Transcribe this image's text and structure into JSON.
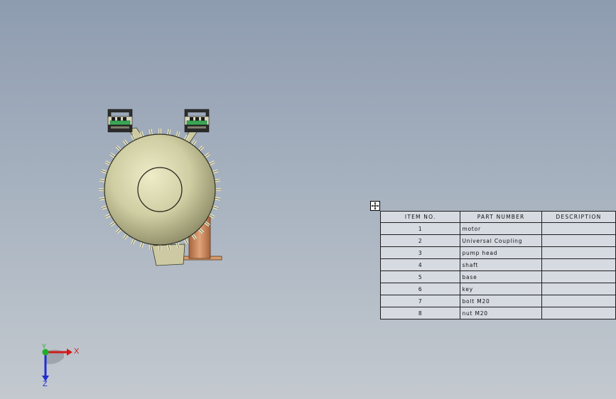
{
  "bom": {
    "headers": [
      "ITEM NO.",
      "PART NUMBER",
      "DESCRIPTION"
    ],
    "rows": [
      {
        "item": "1",
        "part": "motor",
        "description": ""
      },
      {
        "item": "2",
        "part": "Universal Coupling",
        "description": ""
      },
      {
        "item": "3",
        "part": "pump head",
        "description": ""
      },
      {
        "item": "4",
        "part": "shaft",
        "description": ""
      },
      {
        "item": "5",
        "part": "base",
        "description": ""
      },
      {
        "item": "6",
        "part": "key",
        "description": ""
      },
      {
        "item": "7",
        "part": "bolt M20",
        "description": ""
      },
      {
        "item": "8",
        "part": "nut M20",
        "description": ""
      }
    ]
  },
  "triad": {
    "x_label": "X",
    "y_label": "Y",
    "z_label": "Z"
  },
  "colors": {
    "motor_body": "#c9c79a",
    "motor_rim": "#30301f",
    "coupling": "#c98a5c",
    "terminal_green": "#3aa655",
    "axis_x": "#d21a1a",
    "axis_y": "#1fae2a",
    "axis_z": "#1f2ed2"
  },
  "icons": [
    "move-table-icon",
    "coordinate-triad-icon"
  ]
}
